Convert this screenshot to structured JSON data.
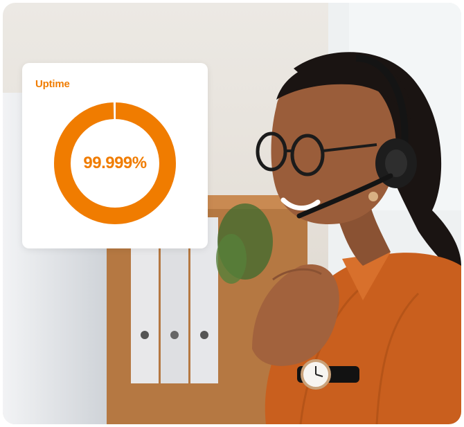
{
  "uptime_card": {
    "title": "Uptime",
    "value_text": "99.999%",
    "fraction": 0.99999,
    "accent_color": "#F07C00",
    "track_color": "#F3D9BF"
  },
  "photo": {
    "subject": "smiling-agent-with-headset"
  }
}
